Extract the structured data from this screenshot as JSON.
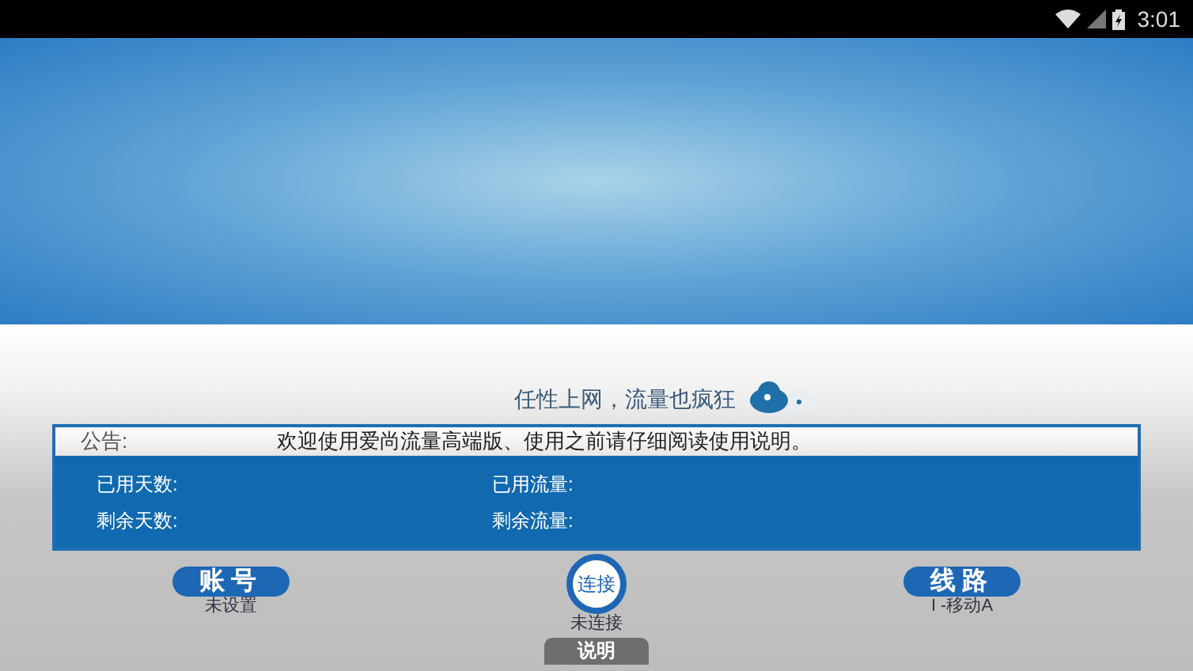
{
  "status_bar": {
    "time": "3:01"
  },
  "slogan": "任性上网，流量也疯狂",
  "notice": {
    "label": "公告:",
    "text": "欢迎使用爱尚流量高端版、使用之前请仔细阅读使用说明。"
  },
  "stats": [
    {
      "label": "已用天数:"
    },
    {
      "label": "已用流量:"
    },
    {
      "label": "剩余天数:"
    },
    {
      "label": "剩余流量:"
    }
  ],
  "account": {
    "label": "账号",
    "status": "未设置"
  },
  "connect": {
    "label": "连接",
    "status": "未连接"
  },
  "route": {
    "label": "线路",
    "status": "I -移动A"
  },
  "help_button": {
    "label": "说明"
  }
}
